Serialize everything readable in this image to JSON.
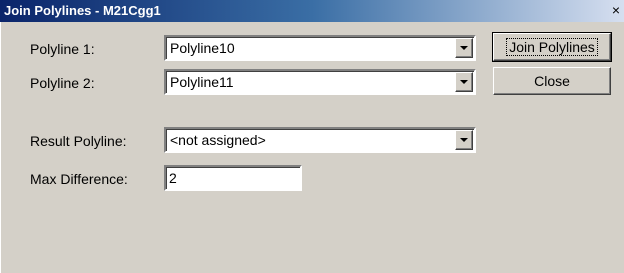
{
  "window": {
    "title": "Join Polylines - M21Cgg1",
    "close_glyph": "×"
  },
  "form": {
    "polyline1": {
      "label": "Polyline 1:",
      "value": "Polyline10"
    },
    "polyline2": {
      "label": "Polyline 2:",
      "value": "Polyline11"
    },
    "result": {
      "label": "Result Polyline:",
      "value": "<not assigned>"
    },
    "max_difference": {
      "label": "Max Difference:",
      "value": "2"
    }
  },
  "buttons": {
    "join_label": "Join Polylines",
    "close_label": "Close"
  },
  "icons": {
    "dropdown": "chevron-down-icon",
    "close": "close-icon"
  }
}
